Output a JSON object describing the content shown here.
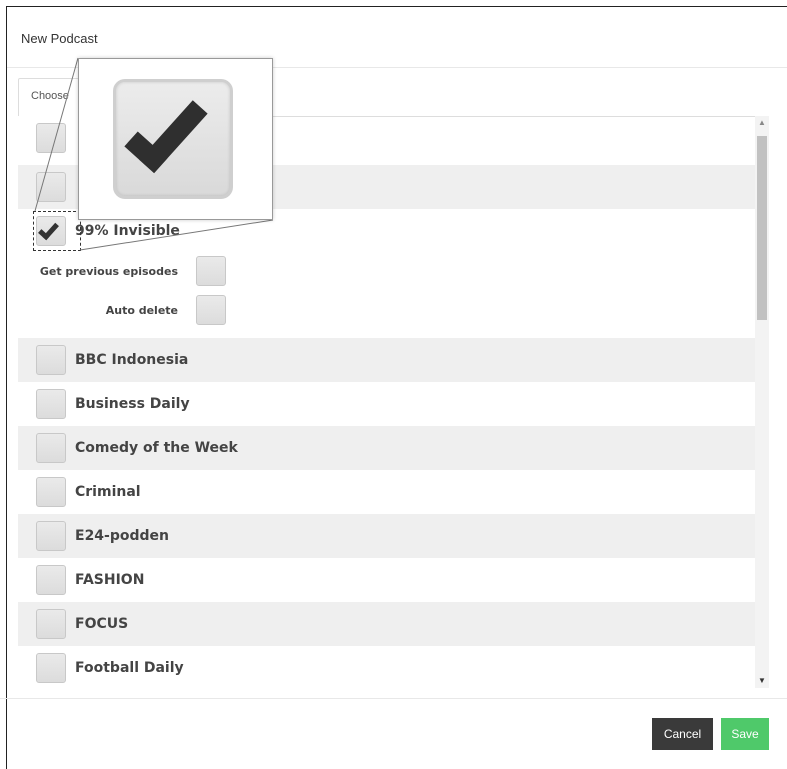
{
  "dialog": {
    "title": "New Podcast",
    "tab_label": "Choose"
  },
  "podcasts": [
    {
      "label": "",
      "checked": false
    },
    {
      "label": "",
      "checked": false
    },
    {
      "label": "99% Invisible",
      "checked": true
    },
    {
      "label": "BBC Indonesia",
      "checked": false
    },
    {
      "label": "Business Daily",
      "checked": false
    },
    {
      "label": "Comedy of the Week",
      "checked": false
    },
    {
      "label": "Criminal",
      "checked": false
    },
    {
      "label": "E24-podden",
      "checked": false
    },
    {
      "label": "FASHION",
      "checked": false
    },
    {
      "label": "FOCUS",
      "checked": false
    },
    {
      "label": "Football Daily",
      "checked": false
    }
  ],
  "options": {
    "previous_label": "Get previous episodes",
    "previous_checked": false,
    "auto_delete_label": "Auto delete",
    "auto_delete_checked": false
  },
  "buttons": {
    "cancel": "Cancel",
    "save": "Save"
  },
  "scrollbar": {
    "up_icon": "▲",
    "down_icon": "▼"
  },
  "colors": {
    "save": "#4fc96a",
    "cancel": "#3a3a3a"
  }
}
